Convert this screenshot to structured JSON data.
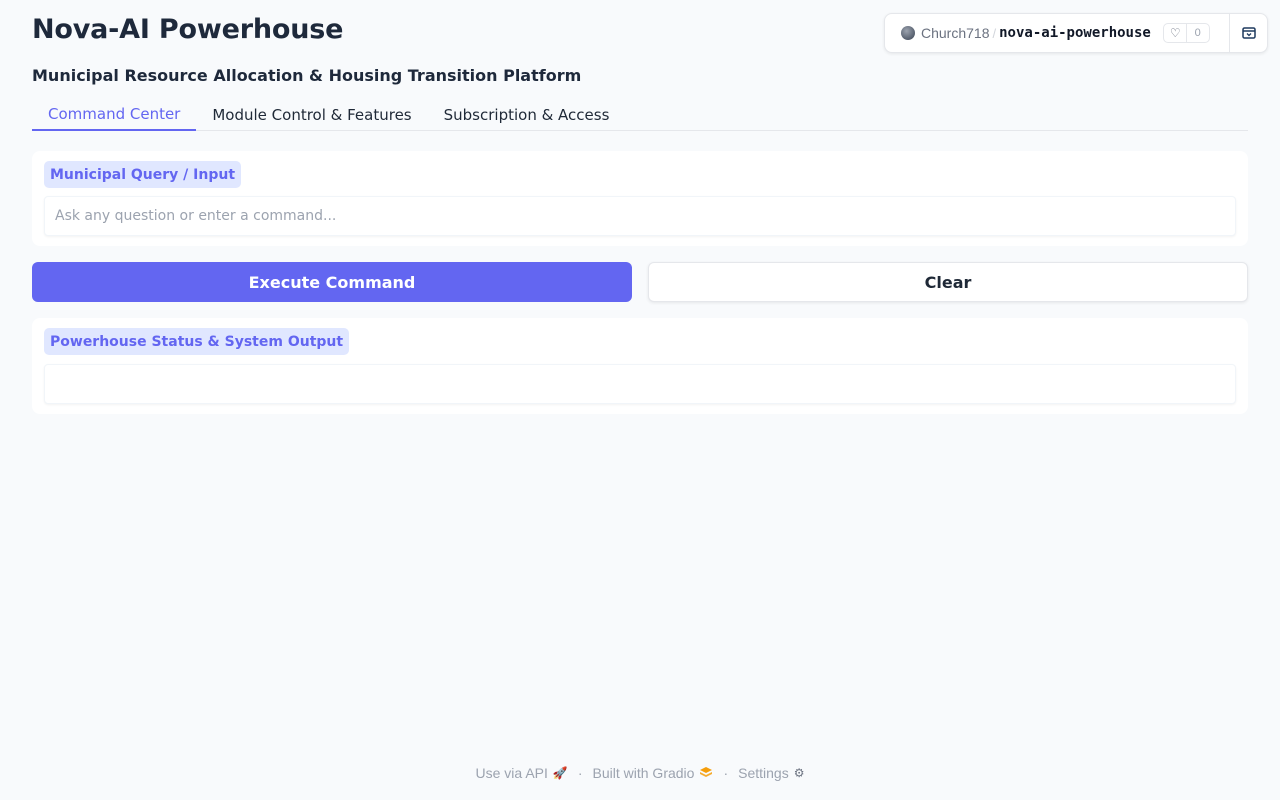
{
  "app": {
    "title": "Nova-AI Powerhouse",
    "subtitle": "Municipal Resource Allocation & Housing Transition Platform"
  },
  "space_badge": {
    "owner": "Church718",
    "separator": "/",
    "repo": "nova-ai-powerhouse",
    "likes": "0"
  },
  "tabs": [
    {
      "label": "Command Center",
      "active": true
    },
    {
      "label": "Module Control & Features",
      "active": false
    },
    {
      "label": "Subscription & Access",
      "active": false
    }
  ],
  "query_panel": {
    "label": "Municipal Query / Input",
    "placeholder": "Ask any question or enter a command...",
    "value": ""
  },
  "buttons": {
    "execute": "Execute Command",
    "clear": "Clear"
  },
  "output_panel": {
    "label": "Powerhouse Status & System Output",
    "value": ""
  },
  "footer": {
    "api_label": "Use via API",
    "gradio_label": "Built with Gradio",
    "settings_label": "Settings",
    "separator": "·"
  },
  "colors": {
    "accent": "#6366f1",
    "accent_light": "#e0e7ff",
    "background": "#f8fafc"
  }
}
